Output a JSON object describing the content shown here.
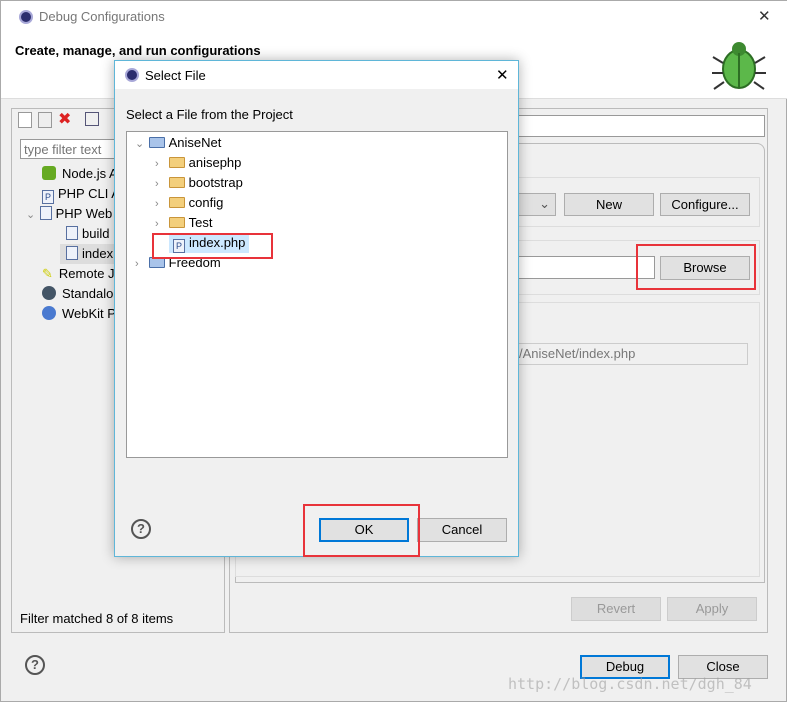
{
  "window": {
    "title": "Debug Configurations",
    "header": "Create, manage, and run configurations",
    "close": "✕"
  },
  "left": {
    "filter_placeholder": "type filter text",
    "items": [
      {
        "label": "Node.js Application",
        "icon": "nodejs-icon"
      },
      {
        "label": "PHP CLI Application",
        "icon": "php-cli-icon"
      },
      {
        "label": "PHP Web Application",
        "icon": "php-web-icon"
      },
      {
        "label": "build",
        "icon": "php-web-config-icon"
      },
      {
        "label": "index",
        "icon": "php-web-config-icon"
      },
      {
        "label": "Remote JavaScript",
        "icon": "remote-js-icon"
      },
      {
        "label": "Standalone",
        "icon": "standalone-icon"
      },
      {
        "label": "WebKit Protocol",
        "icon": "webkit-icon"
      }
    ],
    "status": "Filter matched 8 of 8 items"
  },
  "right": {
    "new": "New",
    "configure": "Configure...",
    "browse": "Browse",
    "file_path": "/AniseNet/index.php",
    "revert": "Revert",
    "apply": "Apply"
  },
  "bottom": {
    "debug": "Debug",
    "close": "Close",
    "help": "?"
  },
  "dialog": {
    "title": "Select File",
    "close": "✕",
    "label": "Select a File from the Project",
    "tree": [
      {
        "label": "AniseNet",
        "type": "project",
        "expanded": true,
        "level": 0
      },
      {
        "label": "anisephp",
        "type": "folder",
        "level": 1
      },
      {
        "label": "bootstrap",
        "type": "folder",
        "level": 1
      },
      {
        "label": "config",
        "type": "folder",
        "level": 1
      },
      {
        "label": "Test",
        "type": "folder",
        "level": 1
      },
      {
        "label": "index.php",
        "type": "php-file",
        "level": 1,
        "selected": true
      },
      {
        "label": "Freedom",
        "type": "project",
        "expanded": false,
        "level": 0
      }
    ],
    "ok": "OK",
    "cancel": "Cancel",
    "help": "?"
  },
  "watermark": "http://blog.csdn.net/dgh_84",
  "colors": {
    "highlight": "#e8333a",
    "selection": "#cce8ff",
    "dialog_border": "#5fb6d8"
  }
}
